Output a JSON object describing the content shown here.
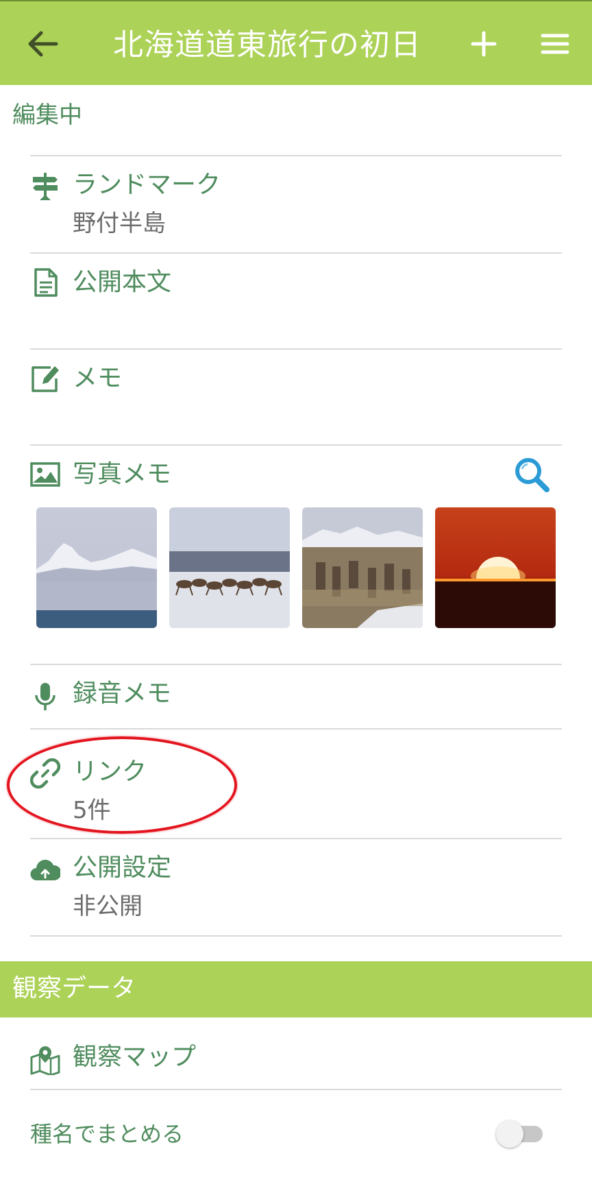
{
  "header": {
    "title": "北海道道東旅行の初日",
    "back_icon": "arrow-left-icon",
    "add_icon": "plus-icon",
    "menu_icon": "hamburger-menu-icon"
  },
  "editing_label": "編集中",
  "fields": {
    "landmark": {
      "title": "ランドマーク",
      "value": "野付半島",
      "icon": "signpost-icon"
    },
    "public_text": {
      "title": "公開本文",
      "icon": "document-icon"
    },
    "memo": {
      "title": "メモ",
      "icon": "edit-note-icon"
    },
    "photo_memo": {
      "title": "写真メモ",
      "icon": "image-icon",
      "search_icon": "search-icon"
    },
    "audio_memo": {
      "title": "録音メモ",
      "icon": "microphone-icon"
    },
    "link": {
      "title": "リンク",
      "value": "5件",
      "icon": "link-icon"
    },
    "publish": {
      "title": "公開設定",
      "value": "非公開",
      "icon": "cloud-upload-icon"
    }
  },
  "photos": [
    {
      "name": "snowy-mountain-photo"
    },
    {
      "name": "running-deer-photo"
    },
    {
      "name": "deer-herd-photo"
    },
    {
      "name": "sunset-photo"
    }
  ],
  "observation": {
    "section_title": "観察データ",
    "map": {
      "title": "観察マップ",
      "icon": "map-pin-icon"
    },
    "group_by_species": {
      "label": "種名でまとめる",
      "enabled": false
    }
  },
  "colors": {
    "header_bg": "#acd257",
    "label_green": "#4f8c5e",
    "search_blue": "#2b9bd6",
    "annotation_red": "#e3141e"
  }
}
